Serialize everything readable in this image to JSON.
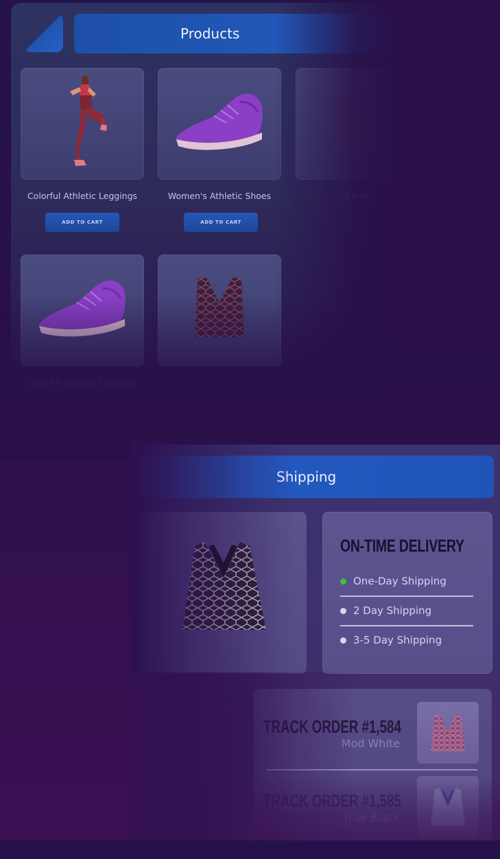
{
  "products": {
    "header_title": "Products",
    "items": [
      {
        "name": "Colorful Athletic Leggings",
        "button": "ADD TO CART"
      },
      {
        "name": "Women's Athletic Shoes",
        "button": "ADD TO CART"
      },
      {
        "name": "Game",
        "button": ""
      },
      {
        "name": "Colorful Athletic Leggings",
        "button": ""
      },
      {
        "name": "",
        "button": ""
      }
    ]
  },
  "shipping": {
    "header_title": "Shipping",
    "delivery": {
      "title": "ON-TIME DELIVERY",
      "options": [
        {
          "label": "One-Day Shipping",
          "selected": true
        },
        {
          "label": "2 Day Shipping",
          "selected": false
        },
        {
          "label": "3-5 Day Shipping",
          "selected": false
        }
      ]
    },
    "orders": [
      {
        "title": "TRACK ORDER #1,584",
        "subtitle": "Mod White"
      },
      {
        "title": "TRACK ORDER #1,585",
        "subtitle": "True Black"
      }
    ]
  },
  "colors": {
    "accent_blue": "#2258b8",
    "background": "#2a1048",
    "active_dot": "#3fc046",
    "shoe_purple": "#8a3fc6"
  }
}
